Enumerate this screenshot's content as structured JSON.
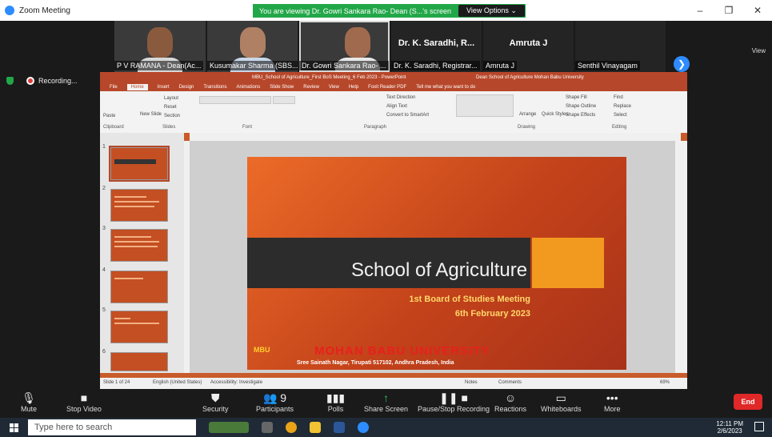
{
  "window": {
    "title": "Zoom Meeting"
  },
  "banner": {
    "message": "You are viewing Dr. Gowri Sankara Rao- Dean (S...'s screen",
    "view_options": "View Options  ⌄"
  },
  "window_buttons": {
    "minimize": "–",
    "maximize": "❐",
    "close": "✕"
  },
  "gallery": {
    "tiles": [
      {
        "name": "P V RAMANA - Dean(Ac..."
      },
      {
        "name": "Kusumakar Sharma (SBS..."
      },
      {
        "name": "Dr. Gowri Sankara Rao- ..."
      },
      {
        "big": "Dr. K. Saradhi, R...",
        "name": "Dr. K. Saradhi, Registrar..."
      },
      {
        "big": "Amruta J",
        "name": "Amruta J"
      },
      {
        "name": "Senthil Vinayagam"
      }
    ],
    "next": "❯",
    "view": "View"
  },
  "recording": {
    "label": "Recording..."
  },
  "ppt": {
    "filename": "MBU_School of Agriculture_First BoS Meeting_6 Feb 2023 - PowerPoint",
    "user": "Dean School of Agriculture Mohan Babu University",
    "tabs": [
      "File",
      "Home",
      "Insert",
      "Design",
      "Transitions",
      "Animations",
      "Slide Show",
      "Review",
      "View",
      "Help",
      "Foxit Reader PDF",
      "Tell me what you want to do"
    ],
    "ribbon": {
      "clipboard": "Clipboard",
      "slides": "Slides",
      "font": "Font",
      "paragraph": "Paragraph",
      "drawing": "Drawing",
      "editing": "Editing",
      "paste": "Paste",
      "new_slide": "New Slide",
      "layout": "Layout",
      "reset": "Reset",
      "section": "Section",
      "text_direction": "Text Direction",
      "align_text": "Align Text",
      "convert_smartart": "Convert to SmartArt",
      "arrange": "Arrange",
      "quick_styles": "Quick Styles",
      "shape_fill": "Shape Fill",
      "shape_outline": "Shape Outline",
      "shape_effects": "Shape Effects",
      "find": "Find",
      "replace": "Replace",
      "select": "Select"
    },
    "slide_nums": [
      "1",
      "2",
      "3",
      "4",
      "5",
      "6"
    ],
    "thumb1_title": "School of Agriculture",
    "slide": {
      "title": "School of Agriculture",
      "sub1": "1st Board of Studies Meeting",
      "sub2": "6th February 2023",
      "logo": "MBU",
      "uni": "MOHAN BABU UNIVERSITY",
      "address": "Sree Sainath Nagar, Tirupati 517102, Andhra Pradesh, India"
    },
    "status": {
      "slide": "Slide 1 of 24",
      "lang": "English (United States)",
      "access": "Accessibility: Investigate",
      "notes": "Notes",
      "comments": "Comments",
      "zoom": "69%"
    }
  },
  "controls": [
    {
      "icon": "🎙",
      "label": "Mute"
    },
    {
      "icon": "■",
      "label": "Stop Video"
    },
    {
      "icon": "⛊",
      "label": "Security"
    },
    {
      "icon": "👥 9",
      "label": "Participants"
    },
    {
      "icon": "▮▮▮",
      "label": "Polls"
    },
    {
      "icon": "↑",
      "label": "Share Screen"
    },
    {
      "icon": "❚❚ ■",
      "label": "Pause/Stop Recording"
    },
    {
      "icon": "☺",
      "label": "Reactions"
    },
    {
      "icon": "▭",
      "label": "Whiteboards"
    },
    {
      "icon": "•••",
      "label": "More"
    }
  ],
  "end": "End",
  "taskbar": {
    "search": "Type here to search",
    "time": "12:11 PM",
    "date": "2/6/2023"
  }
}
